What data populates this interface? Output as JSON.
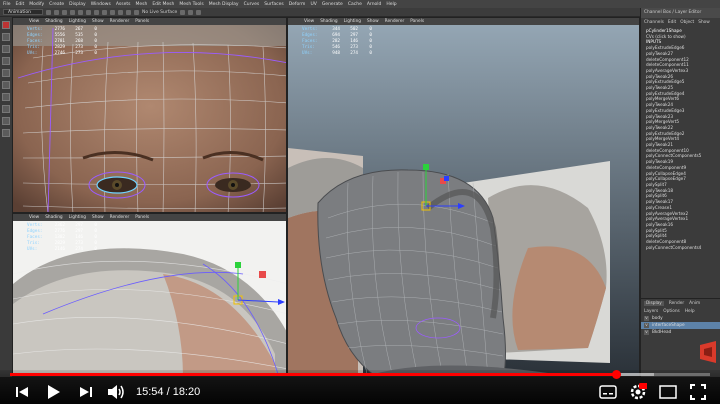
{
  "menubar": [
    "File",
    "Edit",
    "Modify",
    "Create",
    "Display",
    "Windows",
    "Assets",
    "Mesh",
    "Edit Mesh",
    "Mesh Tools",
    "Mesh Display",
    "Curves",
    "Surfaces",
    "Deform",
    "UV",
    "Generate",
    "Cache",
    "Arnold",
    "Help"
  ],
  "shelf": {
    "mode": "Animation",
    "surface_label": "No Live Surface"
  },
  "viewport_menu": [
    "View",
    "Shading",
    "Lighting",
    "Show",
    "Renderer",
    "Panels"
  ],
  "hud": {
    "labels": [
      "Verts:",
      "Edges:",
      "Faces:",
      "Tris:",
      "UVs:"
    ],
    "top_left": [
      [
        "2776",
        "267",
        "0"
      ],
      [
        "5556",
        "535",
        "0"
      ],
      [
        "2781",
        "268",
        "0"
      ],
      [
        "2829",
        "273",
        "0"
      ],
      [
        "2746",
        "273",
        "0"
      ]
    ],
    "main": [
      [
        "344",
        "502",
        "0"
      ],
      [
        "694",
        "297",
        "0"
      ],
      [
        "282",
        "146",
        "0"
      ],
      [
        "546",
        "273",
        "0"
      ],
      [
        "948",
        "274",
        "0"
      ]
    ],
    "bottom_left": [
      [
        "2362",
        "297",
        "0"
      ],
      [
        "2776",
        "297",
        "0"
      ],
      [
        "1382",
        "146",
        "0"
      ],
      [
        "2829",
        "273",
        "0"
      ],
      [
        "2146",
        "274",
        "0"
      ]
    ]
  },
  "channel_box": {
    "title": "Channel Box / Layer Editor",
    "menu": [
      "Channels",
      "Edit",
      "Object",
      "Show"
    ],
    "object": "pCylinder1Shape",
    "cvs": "CVs (click to show)",
    "inputs_header": "INPUTS",
    "inputs": [
      "polyExtrudeEdge6",
      "polyTweak27",
      "deleteComponent12",
      "deleteComponent11",
      "polyAverageVertex3",
      "polyTweak26",
      "polyExtrudeEdge5",
      "polyTweak25",
      "polyExtrudeEdge4",
      "polyMergeVert6",
      "polyTweak24",
      "polyExtrudeEdge3",
      "polyTweak23",
      "polyMergeVert5",
      "polyTweak22",
      "polyExtrudeEdge2",
      "polyMergeVert4",
      "polyTweak21",
      "deleteComponent10",
      "polyConnectComponents5",
      "polyTweak19",
      "deleteComponent9",
      "polyCollapseEdge4",
      "polyCollapseEdge7",
      "polySplit7",
      "polyTweak18",
      "polySplit6",
      "polyTweak17",
      "polyCrease1",
      "polyAverageVertex2",
      "polyAverageVertex1",
      "polyTweak16",
      "polySplit5",
      "polySplit4",
      "deleteComponent8",
      "polyConnectComponents4"
    ]
  },
  "layers": {
    "tabs": [
      "Display",
      "Render",
      "Anim"
    ],
    "menu": [
      "Layers",
      "Options",
      "Help"
    ],
    "rows": [
      {
        "label": "body",
        "selected": false
      },
      {
        "label": "interfaceShape",
        "selected": true
      },
      {
        "label": "BkdHead",
        "selected": false
      }
    ]
  },
  "player": {
    "time": "15:54 / 18:20",
    "played_fraction": 0.867,
    "buffered_fraction": 0.92,
    "accent": "#ff0000",
    "buttons": [
      "previous-icon",
      "play-icon",
      "next-icon",
      "volume-icon",
      "captions-icon",
      "settings-icon",
      "miniplayer-icon",
      "theater-icon",
      "fullscreen-icon"
    ]
  }
}
